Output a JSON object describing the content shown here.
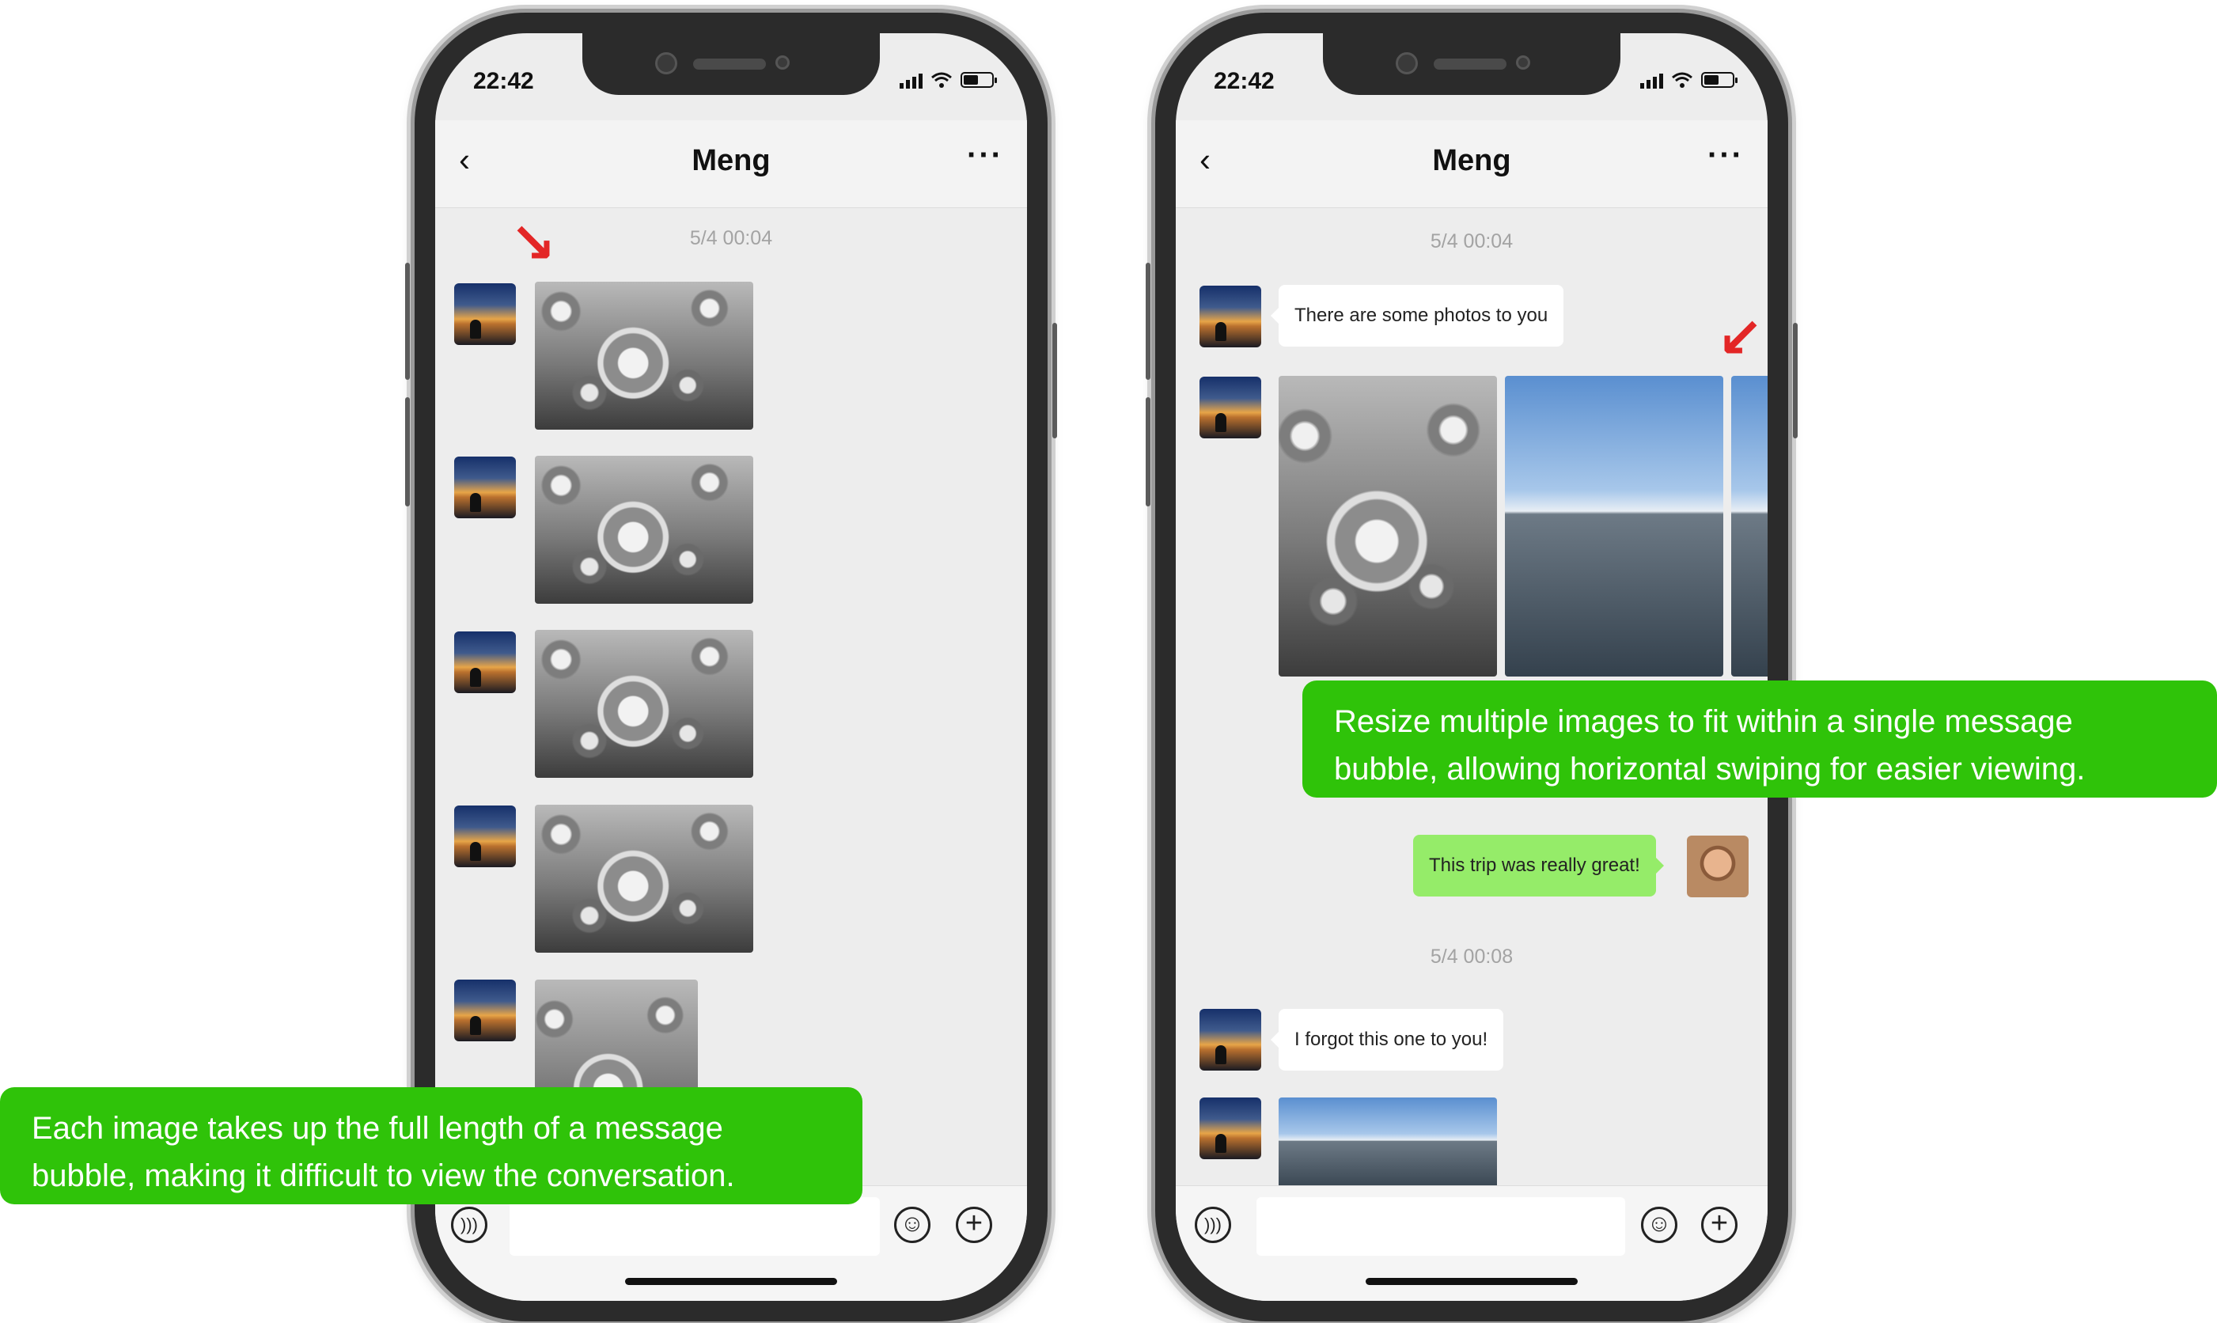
{
  "left_phone": {
    "status_time": "22:42",
    "title": "Meng",
    "timestamp": "5/4 00:04"
  },
  "right_phone": {
    "status_time": "22:42",
    "title": "Meng",
    "timestamp1": "5/4 00:04",
    "msg1": "There are some photos to you",
    "msg2": "This trip was really great!",
    "timestamp2": "5/4 00:08",
    "msg3": "I forgot this one to you!"
  },
  "callouts": {
    "left": "Each image takes up the full length of a message bubble, making it difficult to view the conversation.",
    "right": "Resize multiple images to fit within a single message bubble, allowing horizontal swiping for easier viewing."
  },
  "colors": {
    "callout_green": "#2fc309",
    "my_bubble": "#95ec69",
    "arrow_red": "#e32626",
    "chat_bg": "#ededed"
  },
  "icons": [
    "back-icon",
    "more-icon",
    "voice-icon",
    "emoji-icon",
    "plus-icon",
    "signal-icon",
    "wifi-icon",
    "battery-icon",
    "arrow-icon"
  ]
}
